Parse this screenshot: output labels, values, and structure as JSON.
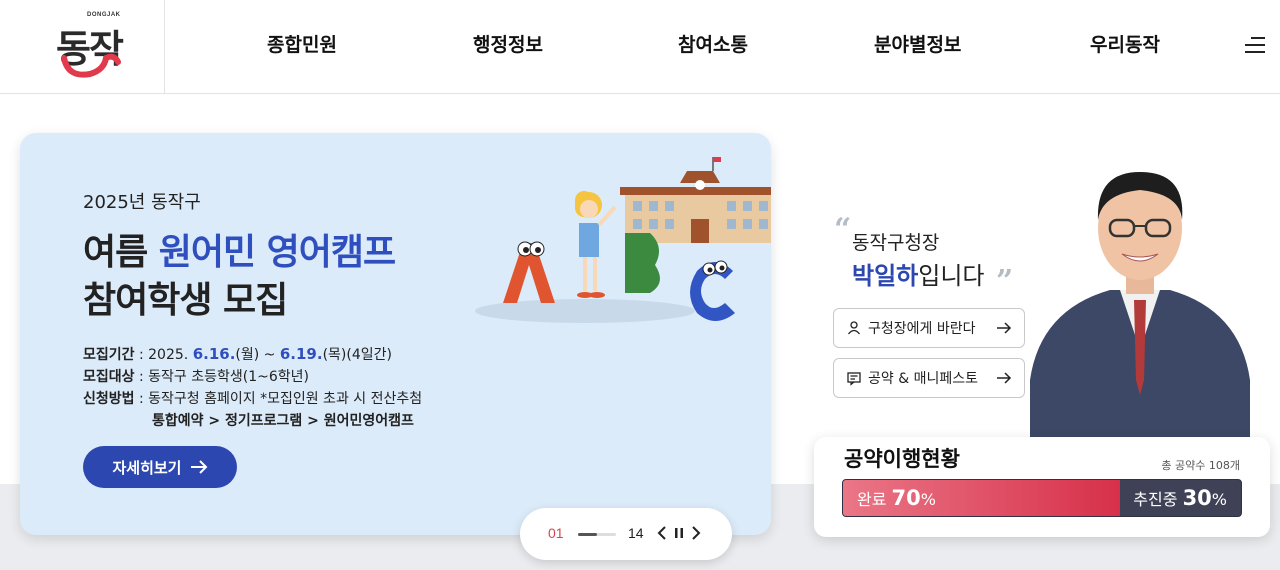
{
  "header": {
    "logo_small": "DONGJAK",
    "logo_text": "동작",
    "nav": [
      "종합민원",
      "행정정보",
      "참여소통",
      "분야별정보",
      "우리동작"
    ]
  },
  "banner": {
    "year_line": "2025년 동작구",
    "title1_pre": "여름 ",
    "title1_hl": "원어민 영어캠프",
    "title2": "참여학생 모집",
    "period_label": "모집기간",
    "period_pre": " : 2025. ",
    "period_start": "6.16.",
    "period_mid1": "(월) ~ ",
    "period_end": "6.19.",
    "period_post": "(목)(4일간)",
    "target_label": "모집대상",
    "target_value": " : 동작구 초등학생(1~6학년)",
    "method_label": "신청방법",
    "method_value": " : 동작구청 홈페이지 *모집인원 초과 시 전산추첨",
    "method_path": "통합예약 > 정기프로그램 > 원어민영어캠프",
    "detail_button": "자세히보기"
  },
  "pager": {
    "current": "01",
    "total": "14",
    "progress": 0.5
  },
  "mayor": {
    "line1": "동작구청장",
    "name": "박일하",
    "name_suffix": "입니다",
    "btn1": "구청장에게 바란다",
    "btn2": "공약 & 매니페스토"
  },
  "promise": {
    "title": "공약이행현황",
    "total": "총 공약수 108개",
    "done_label": "완료",
    "done_value": "70",
    "progress_label": "추진중",
    "progress_value": "30",
    "unit": "%",
    "done_fraction": 0.695
  },
  "colors": {
    "accent_blue": "#2d47b0",
    "banner_bg": "#dcebf9",
    "done_red": "#d7304a",
    "progress_dark": "#3f4256"
  }
}
